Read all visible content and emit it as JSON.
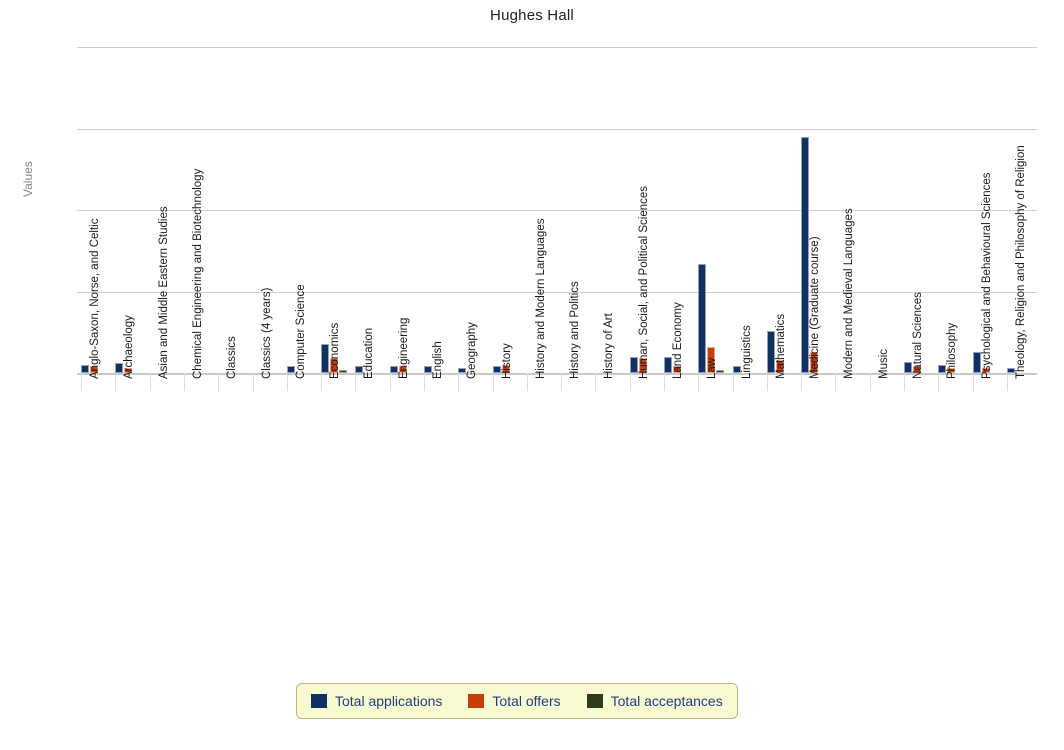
{
  "chart_data": {
    "type": "bar",
    "title": "Hughes Hall",
    "xlabel": "",
    "ylabel": "Values",
    "ylim": [
      0,
      200
    ],
    "yticks": [
      0,
      50,
      100,
      150,
      200
    ],
    "grid": true,
    "legend_position": "bottom",
    "categories": [
      "Anglo-Saxon, Norse, and Celtic",
      "Archaeology",
      "Asian and Middle Eastern Studies",
      "Chemical Engineering and Biotechnology",
      "Classics",
      "Classics (4 years)",
      "Computer Science",
      "Economics",
      "Education",
      "Engineering",
      "English",
      "Geography",
      "History",
      "History and Modern Languages",
      "History and Politics",
      "History of Art",
      "Human, Social, and Political Sciences",
      "Land Economy",
      "Law",
      "Linguistics",
      "Mathematics",
      "Medicine (Graduate course)",
      "Modern and Medieval Languages",
      "Music",
      "Natural Sciences",
      "Philosophy",
      "Psychological and Behavioural Sciences",
      "Theology, Religion and Philosophy of Religion"
    ],
    "series": [
      {
        "name": "Total applications",
        "color": "#123163",
        "values": [
          5,
          6,
          0,
          0,
          0,
          0,
          4,
          18,
          4,
          4,
          4,
          3,
          4,
          0,
          0,
          0,
          10,
          10,
          67,
          4,
          26,
          145,
          0,
          0,
          7,
          5,
          13,
          3
        ]
      },
      {
        "name": "Total offers",
        "color": "#c83e0a",
        "values": [
          4,
          3,
          0,
          0,
          0,
          0,
          0,
          9,
          0,
          4,
          0,
          0,
          5,
          0,
          0,
          0,
          9,
          4,
          16,
          0,
          8,
          13,
          0,
          0,
          4,
          3,
          3,
          0
        ]
      },
      {
        "name": "Total acceptances",
        "color": "#2d3b1c",
        "values": [
          0,
          0,
          0,
          0,
          0,
          0,
          0,
          2,
          0,
          0,
          0,
          0,
          0,
          0,
          0,
          0,
          0,
          0,
          2,
          0,
          0,
          0,
          0,
          0,
          0,
          0,
          0,
          0
        ]
      }
    ]
  },
  "legend": {
    "items": [
      {
        "label": "Total applications",
        "color": "#123163"
      },
      {
        "label": "Total offers",
        "color": "#c83e0a"
      },
      {
        "label": "Total acceptances",
        "color": "#2d3b1c"
      }
    ]
  }
}
